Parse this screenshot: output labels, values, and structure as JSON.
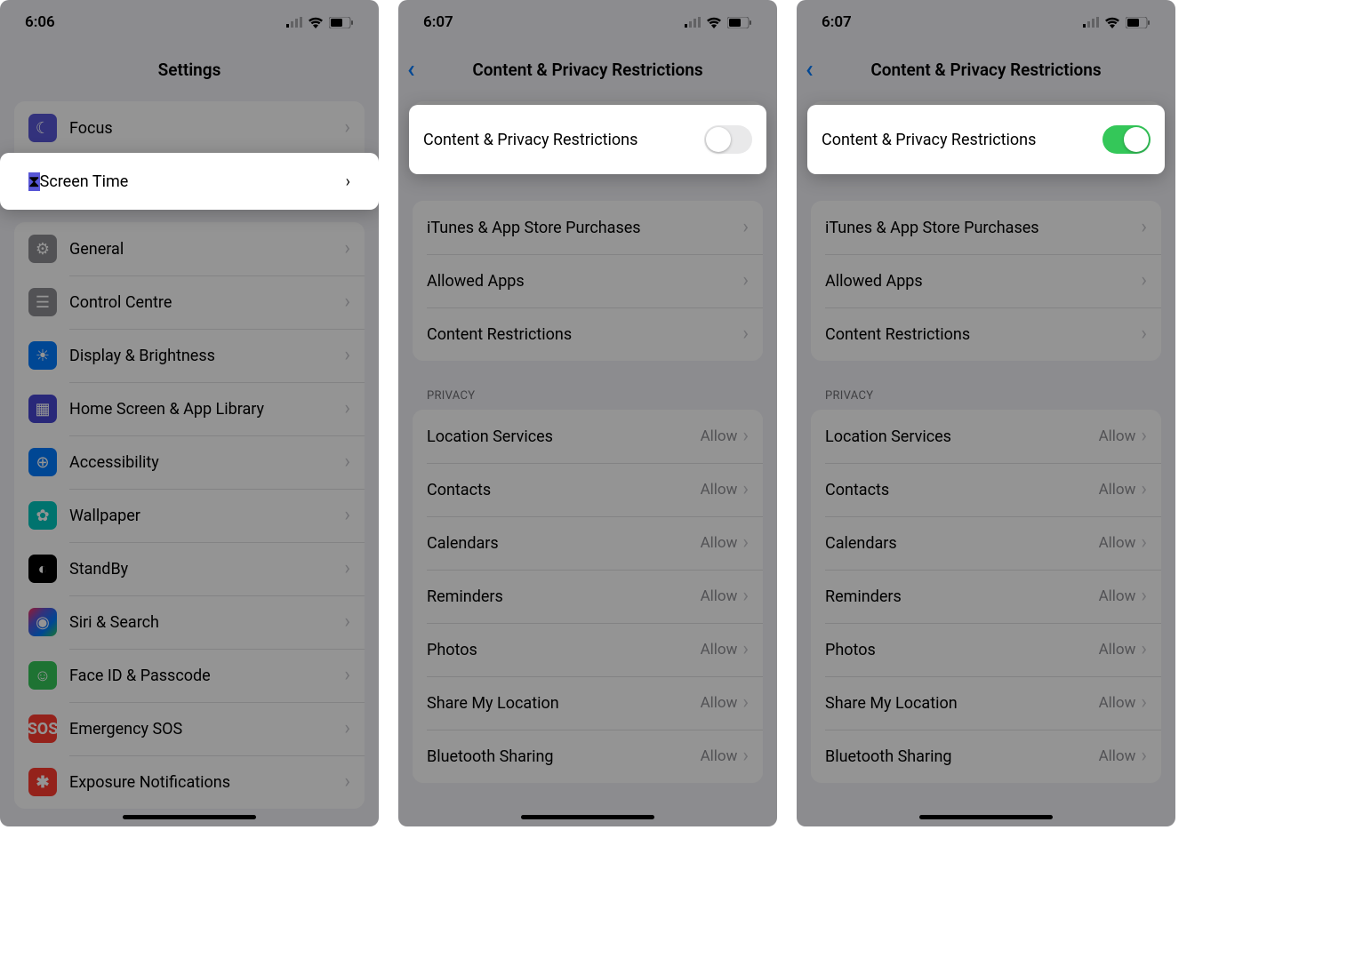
{
  "phone1": {
    "time": "6:06",
    "title": "Settings",
    "group_a": [
      {
        "icon": "moon-icon",
        "iconClass": "ic-focus",
        "label": "Focus"
      },
      {
        "icon": "hourglass-icon",
        "iconClass": "ic-screentime",
        "label": "Screen Time"
      }
    ],
    "group_b": [
      {
        "icon": "gear-icon",
        "iconClass": "ic-general",
        "label": "General"
      },
      {
        "icon": "switches-icon",
        "iconClass": "ic-control",
        "label": "Control Centre"
      },
      {
        "icon": "sun-icon",
        "iconClass": "ic-display",
        "label": "Display & Brightness"
      },
      {
        "icon": "grid-icon",
        "iconClass": "ic-home",
        "label": "Home Screen & App Library"
      },
      {
        "icon": "accessibility-icon",
        "iconClass": "ic-access",
        "label": "Accessibility"
      },
      {
        "icon": "flower-icon",
        "iconClass": "ic-wall",
        "label": "Wallpaper"
      },
      {
        "icon": "clock-icon",
        "iconClass": "ic-standby",
        "label": "StandBy"
      },
      {
        "icon": "siri-icon",
        "iconClass": "ic-siri",
        "label": "Siri & Search"
      },
      {
        "icon": "faceid-icon",
        "iconClass": "ic-faceid",
        "label": "Face ID & Passcode"
      },
      {
        "icon": "sos-icon",
        "iconClass": "ic-sos",
        "label": "Emergency SOS"
      },
      {
        "icon": "virus-icon",
        "iconClass": "ic-sos",
        "label": "Exposure Notifications"
      }
    ],
    "highlight_label": "Screen Time"
  },
  "phone2": {
    "time": "6:07",
    "title": "Content & Privacy Restrictions",
    "toggle_label": "Content & Privacy Restrictions",
    "toggle_on": false,
    "group_a": [
      {
        "label": "iTunes & App Store Purchases"
      },
      {
        "label": "Allowed Apps"
      },
      {
        "label": "Content Restrictions"
      }
    ],
    "privacy_header": "PRIVACY",
    "group_b": [
      {
        "label": "Location Services",
        "value": "Allow"
      },
      {
        "label": "Contacts",
        "value": "Allow"
      },
      {
        "label": "Calendars",
        "value": "Allow"
      },
      {
        "label": "Reminders",
        "value": "Allow"
      },
      {
        "label": "Photos",
        "value": "Allow"
      },
      {
        "label": "Share My Location",
        "value": "Allow"
      },
      {
        "label": "Bluetooth Sharing",
        "value": "Allow"
      }
    ]
  },
  "phone3": {
    "time": "6:07",
    "title": "Content & Privacy Restrictions",
    "toggle_label": "Content & Privacy Restrictions",
    "toggle_on": true,
    "group_a": [
      {
        "label": "iTunes & App Store Purchases"
      },
      {
        "label": "Allowed Apps"
      },
      {
        "label": "Content Restrictions"
      }
    ],
    "privacy_header": "PRIVACY",
    "group_b": [
      {
        "label": "Location Services",
        "value": "Allow"
      },
      {
        "label": "Contacts",
        "value": "Allow"
      },
      {
        "label": "Calendars",
        "value": "Allow"
      },
      {
        "label": "Reminders",
        "value": "Allow"
      },
      {
        "label": "Photos",
        "value": "Allow"
      },
      {
        "label": "Share My Location",
        "value": "Allow"
      },
      {
        "label": "Bluetooth Sharing",
        "value": "Allow"
      }
    ]
  }
}
